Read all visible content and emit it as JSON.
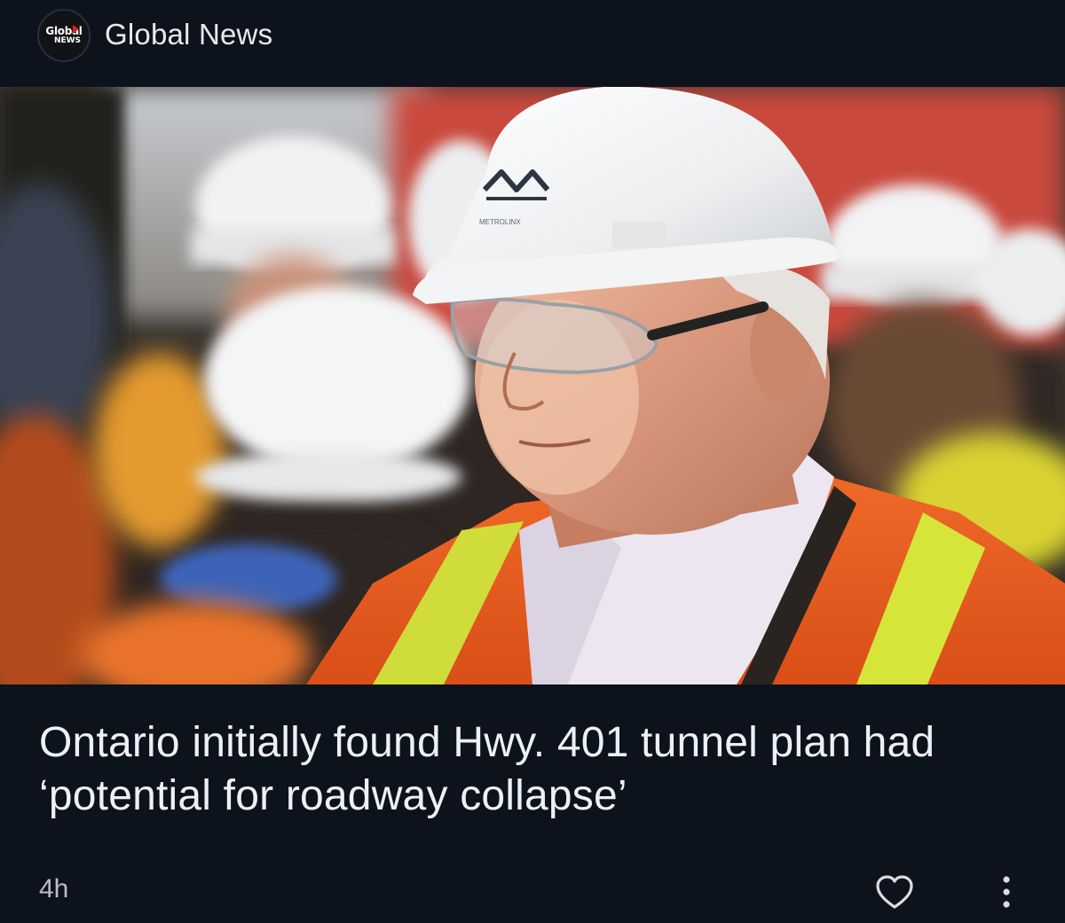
{
  "header": {
    "logo": {
      "word": "Global",
      "sub": "NEWS"
    },
    "source_name": "Global News"
  },
  "photo": {
    "helmet_logo_text": "METROLINX"
  },
  "article": {
    "headline": "Ontario initially found Hwy. 401 tunnel plan had ‘potential for roadway collapse’",
    "timestamp": "4h"
  },
  "actions": {
    "like_icon": "heart-outline-icon",
    "more_icon": "more-vertical-icon"
  },
  "colors": {
    "background": "#0d131d",
    "text": "#eef0f4",
    "muted": "#b9bec7",
    "logo_red": "#e2231a"
  }
}
